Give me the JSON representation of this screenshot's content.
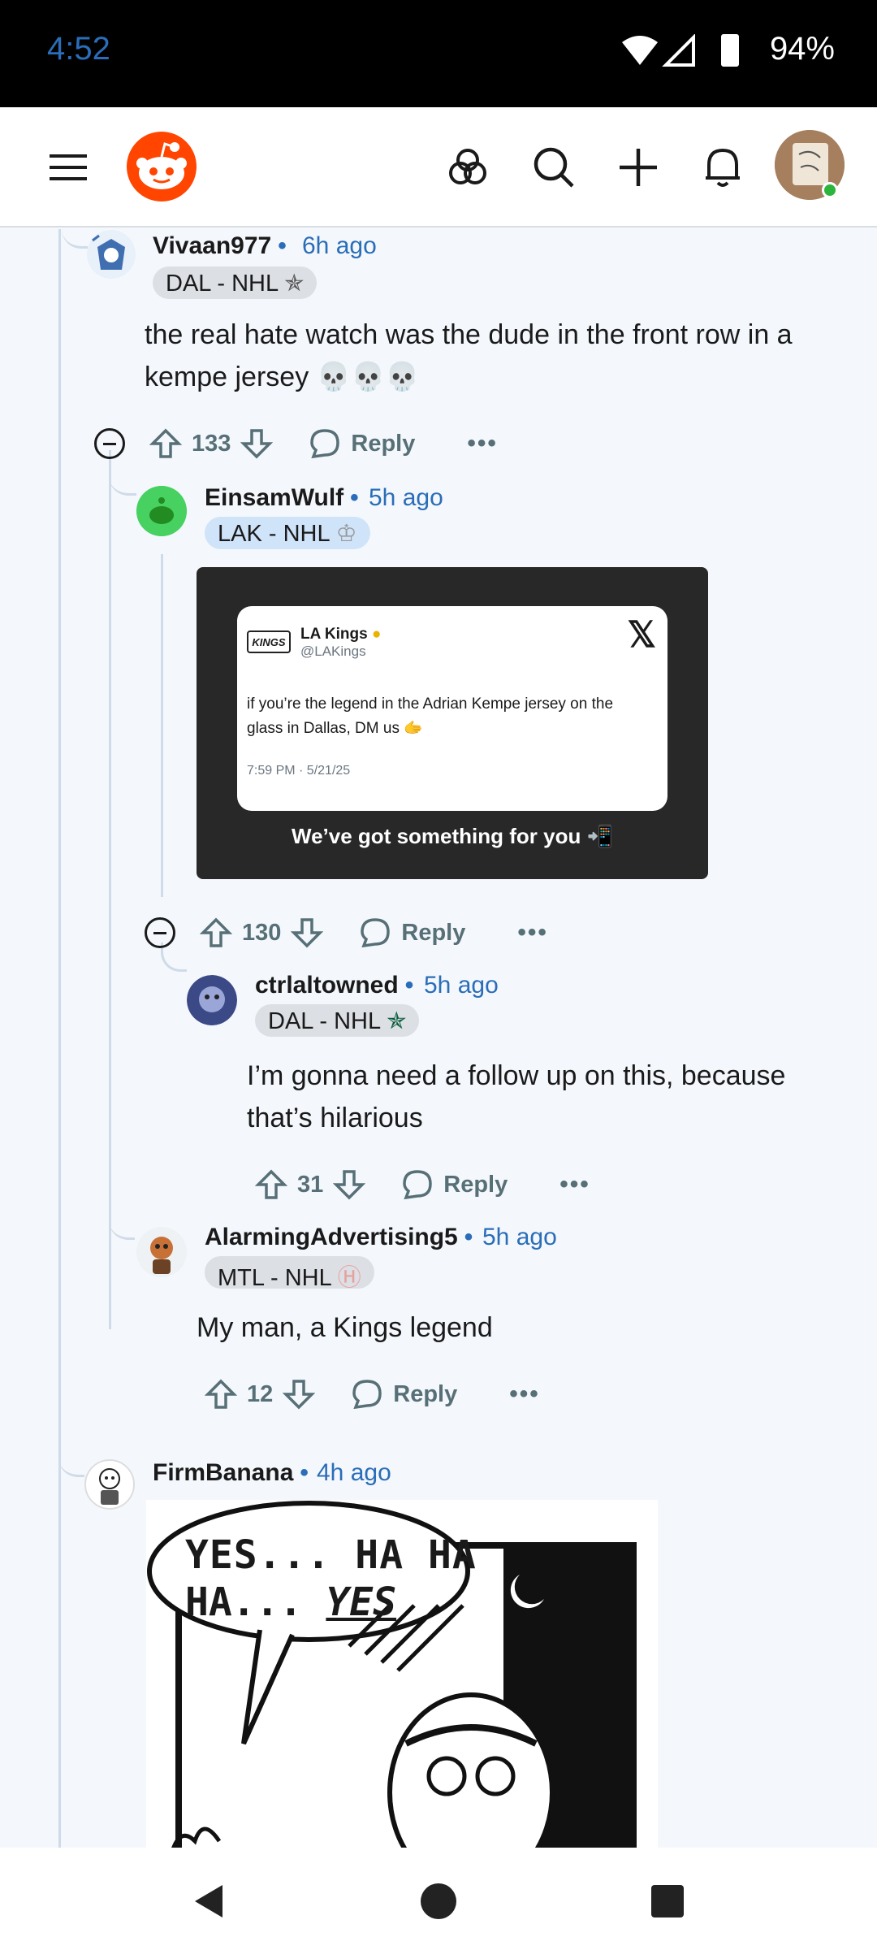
{
  "status_bar": {
    "time": "4:52",
    "battery": "94%"
  },
  "header": {
    "icons": [
      "menu-icon",
      "reddit-logo",
      "explore-icon",
      "search-icon",
      "create-icon",
      "notifications-icon",
      "user-avatar"
    ]
  },
  "comments": [
    {
      "user": "Vivaan977",
      "time": "6h ago",
      "flair": "DAL - NHL",
      "body": "the real hate watch was the dude in the front row in a kempe jersey 💀💀💀",
      "votes": "133",
      "reply_label": "Reply",
      "more": "•••"
    },
    {
      "user": "EinsamWulf",
      "time": "5h ago",
      "flair": "LAK - NHL",
      "embed": {
        "account_name": "LA Kings",
        "account_handle": "@LAKings",
        "logo_text": "KINGS",
        "tweet_text": "if you’re the legend in the Adrian Kempe jersey on the glass in Dallas, DM us 🫱",
        "timestamp": "7:59 PM · 5/21/25",
        "x_logo": "𝕏",
        "caption": "We’ve got something for you 📲"
      },
      "votes": "130",
      "reply_label": "Reply",
      "more": "•••"
    },
    {
      "user": "ctrlaltowned",
      "time": "5h ago",
      "flair": "DAL - NHL",
      "body": "I’m gonna need a follow up on this, because that’s hilarious",
      "votes": "31",
      "reply_label": "Reply",
      "more": "•••"
    },
    {
      "user": "AlarmingAdvertising5",
      "time": "5h ago",
      "flair": "MTL - NHL",
      "body": "My man, a Kings legend",
      "votes": "12",
      "reply_label": "Reply",
      "more": "•••"
    },
    {
      "user": "FirmBanana",
      "time": "4h ago",
      "comic": {
        "speech_line1": "YES... HA HA",
        "speech_line2_a": "HA... ",
        "speech_line2_b": "YES"
      }
    }
  ],
  "colors": {
    "accent": "#ff4500",
    "link": "#2a6db8",
    "thread": "#cfdbe8"
  }
}
